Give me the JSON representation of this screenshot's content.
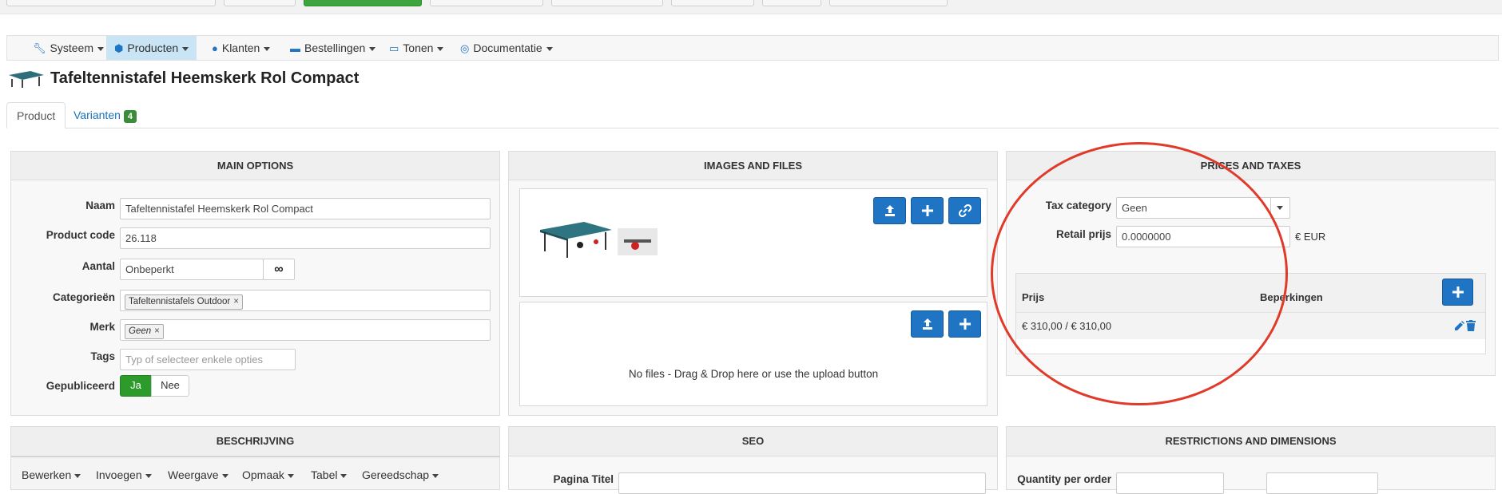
{
  "menu": {
    "items": [
      {
        "label": "Systeem",
        "icon": "wrench-icon"
      },
      {
        "label": "Producten",
        "icon": "cubes-icon"
      },
      {
        "label": "Klanten",
        "icon": "user-icon"
      },
      {
        "label": "Bestellingen",
        "icon": "credit-card-icon"
      },
      {
        "label": "Tonen",
        "icon": "monitor-icon"
      },
      {
        "label": "Documentatie",
        "icon": "lifebuoy-icon"
      }
    ],
    "active": "Producten"
  },
  "page": {
    "title": "Tafeltennistafel Heemskerk Rol Compact"
  },
  "tabs": [
    {
      "label": "Product"
    },
    {
      "label": "Varianten",
      "badge": "4"
    }
  ],
  "main_options": {
    "heading": "MAIN OPTIONS",
    "naam_label": "Naam",
    "naam_value": "Tafeltennistafel Heemskerk Rol Compact",
    "code_label": "Product code",
    "code_value": "26.118",
    "aantal_label": "Aantal",
    "aantal_value": "Onbeperkt",
    "categorie_label": "Categorieën",
    "categorie_tag": "Tafeltennistafels Outdoor",
    "merk_label": "Merk",
    "merk_tag": "Geen",
    "tags_label": "Tags",
    "tags_placeholder": "Typ of selecteer enkele opties",
    "gepubliceerd_label": "Gepubliceerd",
    "ja": "Ja",
    "nee": "Nee"
  },
  "images": {
    "heading": "IMAGES AND FILES",
    "no_files": "No files - Drag & Drop here or use the upload button"
  },
  "prices": {
    "heading": "PRICES AND TAXES",
    "tax_label": "Tax category",
    "tax_value": "Geen",
    "retail_label": "Retail prijs",
    "retail_value": "0.0000000",
    "currency": "€ EUR",
    "col_prijs": "Prijs",
    "col_beperkingen": "Beperkingen",
    "row_price": "€ 310,00 / € 310,00"
  },
  "beschrijving": {
    "heading": "BESCHRIJVING",
    "menu": [
      "Bewerken",
      "Invoegen",
      "Weergave",
      "Opmaak",
      "Tabel",
      "Gereedschap"
    ]
  },
  "seo": {
    "heading": "SEO",
    "partial_label": "Pagina Titel"
  },
  "restrictions": {
    "heading": "RESTRICTIONS AND DIMENSIONS",
    "partial_label": "Quantity per order"
  },
  "colors": {
    "primary": "#1f74c4",
    "success": "#2c9b2c",
    "annotation": "#e03a2a"
  }
}
